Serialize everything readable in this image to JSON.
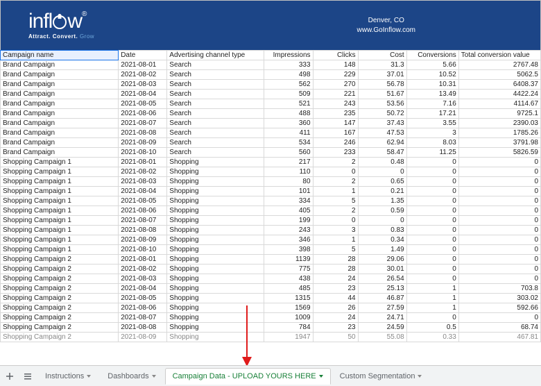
{
  "banner": {
    "logo_prefix": "infl",
    "logo_suffix": "w",
    "reg": "®",
    "tagline_a": "Attract.",
    "tagline_b": "Convert.",
    "tagline_c": "Grow",
    "location": "Denver, CO",
    "site": "www.GoInflow.com"
  },
  "headers": [
    "Campaign name",
    "Date",
    "Advertising channel type",
    "Impressions",
    "Clicks",
    "Cost",
    "Conversions",
    "Total conversion value"
  ],
  "rows": [
    [
      "Brand Campaign",
      "2021-08-01",
      "Search",
      "333",
      "148",
      "31.3",
      "5.66",
      "2767.48"
    ],
    [
      "Brand Campaign",
      "2021-08-02",
      "Search",
      "498",
      "229",
      "37.01",
      "10.52",
      "5062.5"
    ],
    [
      "Brand Campaign",
      "2021-08-03",
      "Search",
      "562",
      "270",
      "56.78",
      "10.31",
      "6408.37"
    ],
    [
      "Brand Campaign",
      "2021-08-04",
      "Search",
      "509",
      "221",
      "51.67",
      "13.49",
      "4422.24"
    ],
    [
      "Brand Campaign",
      "2021-08-05",
      "Search",
      "521",
      "243",
      "53.56",
      "7.16",
      "4114.67"
    ],
    [
      "Brand Campaign",
      "2021-08-06",
      "Search",
      "488",
      "235",
      "50.72",
      "17.21",
      "9725.1"
    ],
    [
      "Brand Campaign",
      "2021-08-07",
      "Search",
      "360",
      "147",
      "37.43",
      "3.55",
      "2390.03"
    ],
    [
      "Brand Campaign",
      "2021-08-08",
      "Search",
      "411",
      "167",
      "47.53",
      "3",
      "1785.26"
    ],
    [
      "Brand Campaign",
      "2021-08-09",
      "Search",
      "534",
      "246",
      "62.94",
      "8.03",
      "3791.98"
    ],
    [
      "Brand Campaign",
      "2021-08-10",
      "Search",
      "560",
      "233",
      "58.47",
      "11.25",
      "5826.59"
    ],
    [
      "Shopping Campaign 1",
      "2021-08-01",
      "Shopping",
      "217",
      "2",
      "0.48",
      "0",
      "0"
    ],
    [
      "Shopping Campaign 1",
      "2021-08-02",
      "Shopping",
      "110",
      "0",
      "0",
      "0",
      "0"
    ],
    [
      "Shopping Campaign 1",
      "2021-08-03",
      "Shopping",
      "80",
      "2",
      "0.65",
      "0",
      "0"
    ],
    [
      "Shopping Campaign 1",
      "2021-08-04",
      "Shopping",
      "101",
      "1",
      "0.21",
      "0",
      "0"
    ],
    [
      "Shopping Campaign 1",
      "2021-08-05",
      "Shopping",
      "334",
      "5",
      "1.35",
      "0",
      "0"
    ],
    [
      "Shopping Campaign 1",
      "2021-08-06",
      "Shopping",
      "405",
      "2",
      "0.59",
      "0",
      "0"
    ],
    [
      "Shopping Campaign 1",
      "2021-08-07",
      "Shopping",
      "199",
      "0",
      "0",
      "0",
      "0"
    ],
    [
      "Shopping Campaign 1",
      "2021-08-08",
      "Shopping",
      "243",
      "3",
      "0.83",
      "0",
      "0"
    ],
    [
      "Shopping Campaign 1",
      "2021-08-09",
      "Shopping",
      "346",
      "1",
      "0.34",
      "0",
      "0"
    ],
    [
      "Shopping Campaign 1",
      "2021-08-10",
      "Shopping",
      "398",
      "5",
      "1.49",
      "0",
      "0"
    ],
    [
      "Shopping Campaign 2",
      "2021-08-01",
      "Shopping",
      "1139",
      "28",
      "29.06",
      "0",
      "0"
    ],
    [
      "Shopping Campaign 2",
      "2021-08-02",
      "Shopping",
      "775",
      "28",
      "30.01",
      "0",
      "0"
    ],
    [
      "Shopping Campaign 2",
      "2021-08-03",
      "Shopping",
      "438",
      "24",
      "26.54",
      "0",
      "0"
    ],
    [
      "Shopping Campaign 2",
      "2021-08-04",
      "Shopping",
      "485",
      "23",
      "25.13",
      "1",
      "703.8"
    ],
    [
      "Shopping Campaign 2",
      "2021-08-05",
      "Shopping",
      "1315",
      "44",
      "46.87",
      "1",
      "303.02"
    ],
    [
      "Shopping Campaign 2",
      "2021-08-06",
      "Shopping",
      "1569",
      "26",
      "27.59",
      "1",
      "592.66"
    ],
    [
      "Shopping Campaign 2",
      "2021-08-07",
      "Shopping",
      "1009",
      "24",
      "24.71",
      "0",
      "0"
    ],
    [
      "Shopping Campaign 2",
      "2021-08-08",
      "Shopping",
      "784",
      "23",
      "24.59",
      "0.5",
      "68.74"
    ],
    [
      "Shopping Campaign 2",
      "2021-08-09",
      "Shopping",
      "1947",
      "50",
      "55.08",
      "0.33",
      "467.81"
    ]
  ],
  "tabs": {
    "instructions": "Instructions",
    "dashboards": "Dashboards",
    "active": "Campaign Data - UPLOAD YOURS HERE",
    "custom": "Custom Segmentation"
  }
}
